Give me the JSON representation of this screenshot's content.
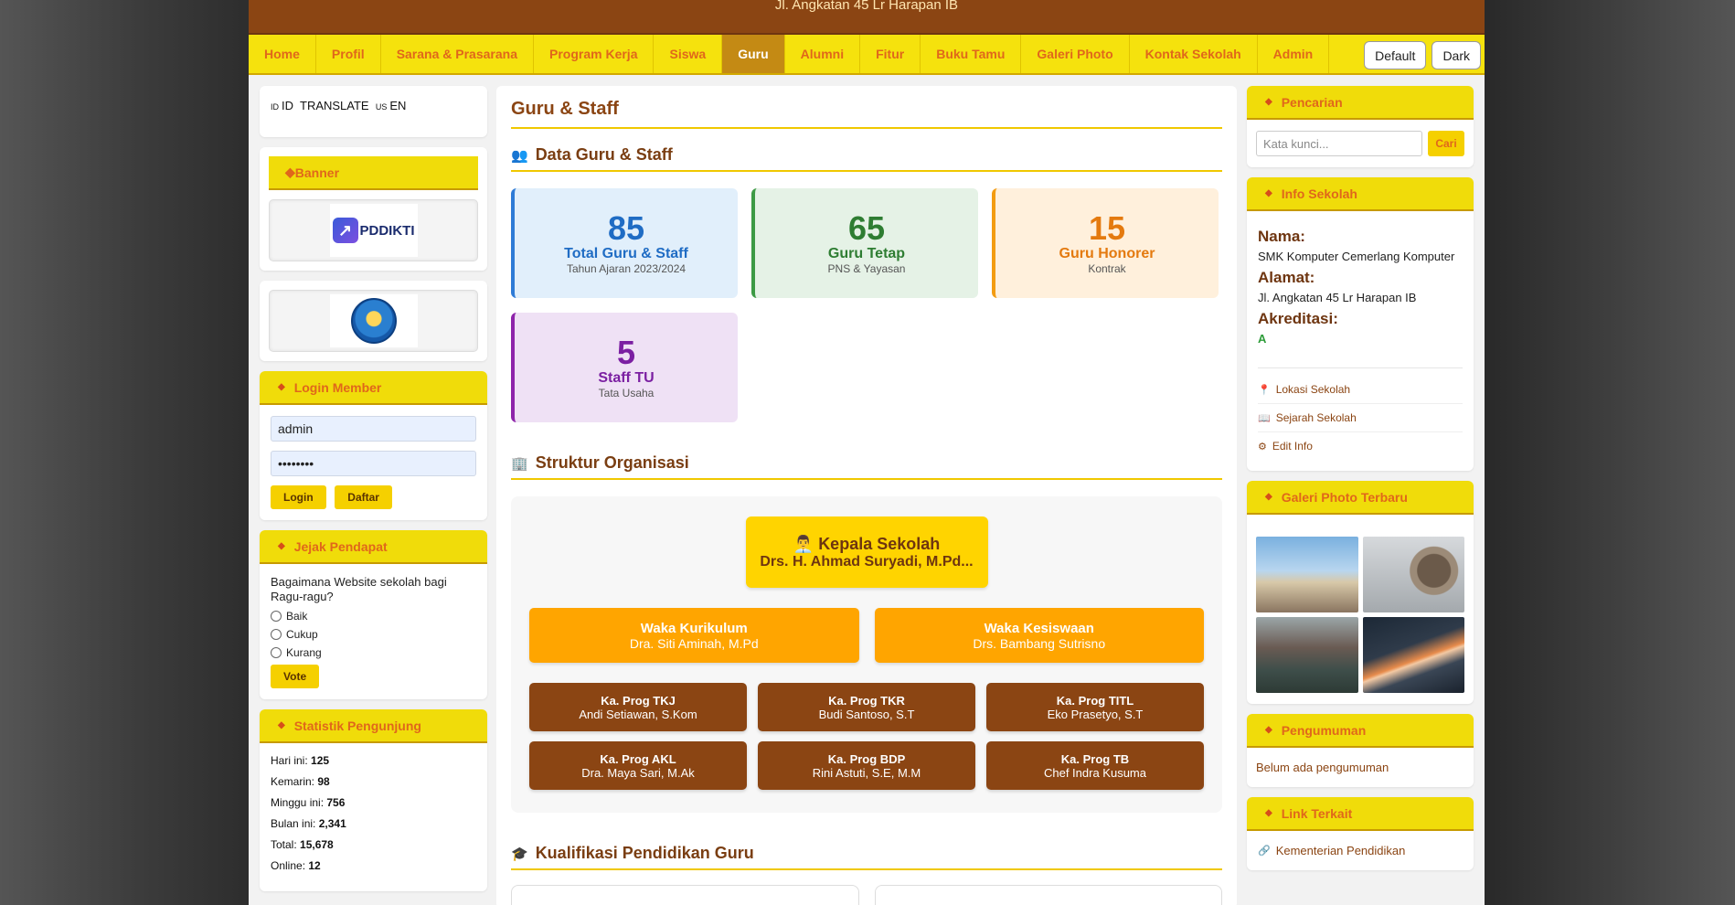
{
  "header": {
    "address": "Jl. Angkatan 45 Lr Harapan IB"
  },
  "nav": {
    "items": [
      "Home",
      "Profil",
      "Sarana & Prasarana",
      "Program Kerja",
      "Siswa",
      "Guru",
      "Alumni",
      "Fitur",
      "Buku Tamu",
      "Galeri Photo",
      "Kontak Sekolah",
      "Admin"
    ],
    "active": "Guru",
    "theme_default": "Default",
    "theme_dark": "Dark"
  },
  "left": {
    "translate": {
      "id_flag": "ID",
      "id_label": "ID",
      "middle": "TRANSLATE",
      "en_flag": "US",
      "en_label": "EN"
    },
    "banner_title": "Banner",
    "pddikti_text": "PDDIKTI",
    "login": {
      "title": "Login Member",
      "username": "admin",
      "password": "••••••••",
      "login_btn": "Login",
      "daftar_btn": "Daftar"
    },
    "poll": {
      "title": "Jejak Pendapat",
      "question": "Bagaimana Website sekolah bagi Ragu-ragu?",
      "options": [
        "Baik",
        "Cukup",
        "Kurang"
      ],
      "vote_btn": "Vote"
    },
    "stats": {
      "title": "Statistik Pengunjung",
      "rows": [
        {
          "label": "Hari ini:",
          "value": "125"
        },
        {
          "label": "Kemarin:",
          "value": "98"
        },
        {
          "label": "Minggu ini:",
          "value": "756"
        },
        {
          "label": "Bulan ini:",
          "value": "2,341"
        },
        {
          "label": "Total:",
          "value": "15,678"
        },
        {
          "label": "Online:",
          "value": "12"
        }
      ]
    }
  },
  "main": {
    "title": "Guru & Staff",
    "data_section": "Data Guru & Staff",
    "cards": [
      {
        "num": "85",
        "label": "Total Guru & Staff",
        "sub": "Tahun Ajaran 2023/2024",
        "color": "#1f6cc4"
      },
      {
        "num": "65",
        "label": "Guru Tetap",
        "sub": "PNS & Yayasan",
        "color": "#2e7d32"
      },
      {
        "num": "15",
        "label": "Guru Honorer",
        "sub": "Kontrak",
        "color": "#e47a0f"
      },
      {
        "num": "5",
        "label": "Staff TU",
        "sub": "Tata Usaha",
        "color": "#7b1fa2"
      }
    ],
    "struktur_section": "Struktur Organisasi",
    "kepala": {
      "title": "Kepala Sekolah",
      "name": "Drs. H. Ahmad Suryadi, M.Pd..."
    },
    "waka": [
      {
        "title": "Waka Kurikulum",
        "name": "Dra. Siti Aminah, M.Pd"
      },
      {
        "title": "Waka Kesiswaan",
        "name": "Drs. Bambang Sutrisno"
      }
    ],
    "kaprog": [
      {
        "title": "Ka. Prog TKJ",
        "name": "Andi Setiawan, S.Kom"
      },
      {
        "title": "Ka. Prog TKR",
        "name": "Budi Santoso, S.T"
      },
      {
        "title": "Ka. Prog TITL",
        "name": "Eko Prasetyo, S.T"
      },
      {
        "title": "Ka. Prog AKL",
        "name": "Dra. Maya Sari, M.Ak"
      },
      {
        "title": "Ka. Prog BDP",
        "name": "Rini Astuti, S.E, M.M"
      },
      {
        "title": "Ka. Prog TB",
        "name": "Chef Indra Kusuma"
      }
    ],
    "kualifikasi_section": "Kualifikasi Pendidikan Guru"
  },
  "right": {
    "search": {
      "title": "Pencarian",
      "placeholder": "Kata kunci...",
      "btn": "Cari"
    },
    "info": {
      "title": "Info Sekolah",
      "nama_label": "Nama:",
      "nama": "SMK Komputer Cemerlang Komputer",
      "alamat_label": "Alamat:",
      "alamat": "Jl. Angkatan 45 Lr Harapan IB",
      "akreditasi_label": "Akreditasi:",
      "akreditasi": "A",
      "links": [
        "Lokasi Sekolah",
        "Sejarah Sekolah",
        "Edit Info"
      ]
    },
    "gallery_title": "Galeri Photo Terbaru",
    "pengumuman": {
      "title": "Pengumuman",
      "text": "Belum ada pengumuman"
    },
    "links": {
      "title": "Link Terkait",
      "items": [
        "Kementerian Pendidikan"
      ]
    }
  }
}
